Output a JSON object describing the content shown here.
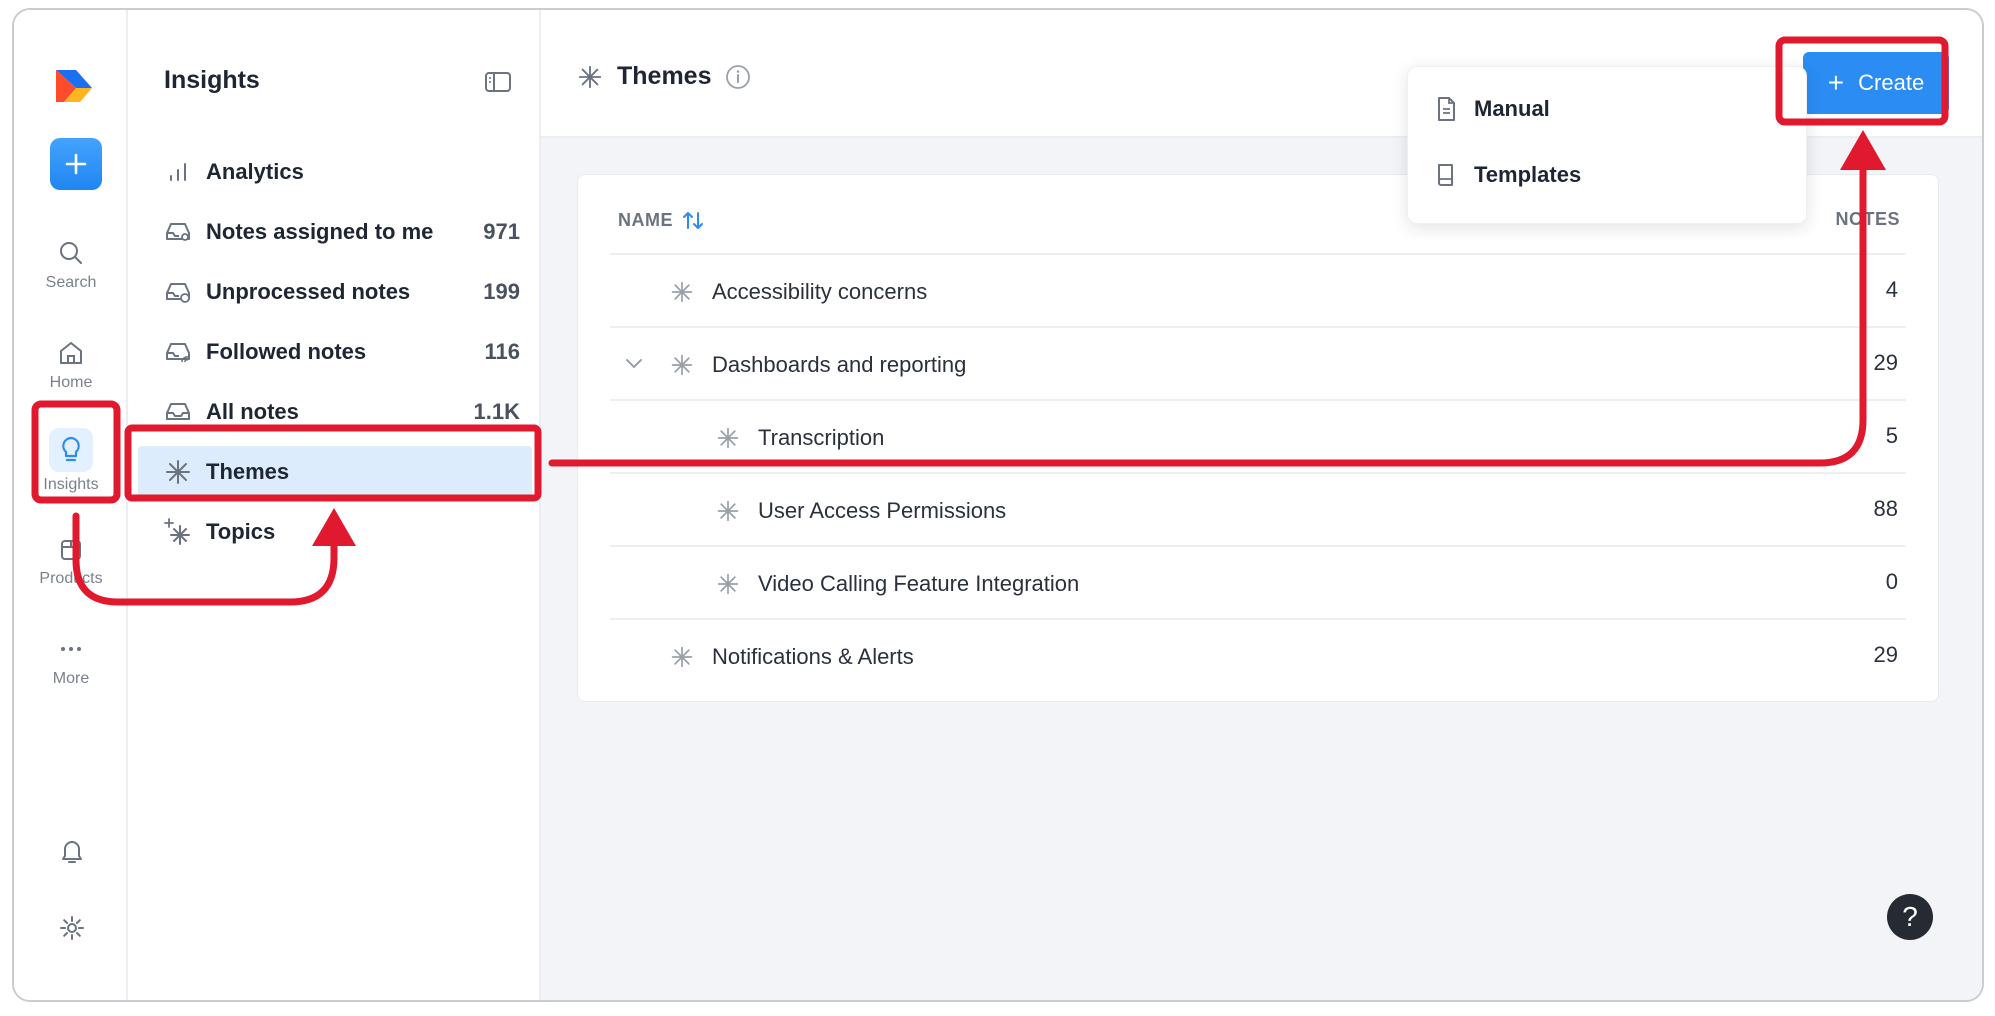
{
  "rail": {
    "items": [
      {
        "label": "Search",
        "icon": "search-icon"
      },
      {
        "label": "Home",
        "icon": "home-icon"
      },
      {
        "label": "Insights",
        "icon": "lightbulb-icon"
      },
      {
        "label": "Products",
        "icon": "box-icon"
      },
      {
        "label": "More",
        "icon": "dots-icon"
      }
    ]
  },
  "sidebar": {
    "title": "Insights",
    "items": [
      {
        "label": "Analytics",
        "count": "",
        "icon": "bar-chart-icon"
      },
      {
        "label": "Notes assigned to me",
        "count": "971",
        "icon": "inbox-user-icon"
      },
      {
        "label": "Unprocessed notes",
        "count": "199",
        "icon": "inbox-clock-icon"
      },
      {
        "label": "Followed notes",
        "count": "116",
        "icon": "inbox-wifi-icon"
      },
      {
        "label": "All notes",
        "count": "1.1K",
        "icon": "inbox-icon"
      },
      {
        "label": "Themes",
        "count": "",
        "icon": "asterisk-icon"
      },
      {
        "label": "Topics",
        "count": "",
        "icon": "sparkle-asterisk-icon"
      }
    ]
  },
  "main": {
    "title": "Themes",
    "create_label": "Create",
    "dropdown": [
      {
        "label": "Manual",
        "icon": "document-icon"
      },
      {
        "label": "Templates",
        "icon": "book-icon"
      }
    ],
    "table": {
      "col_name": "NAME",
      "col_notes": "NOTES",
      "rows": [
        {
          "name": "Accessibility concerns",
          "notes": "4",
          "level": 0,
          "expandable": false
        },
        {
          "name": "Dashboards and reporting",
          "notes": "29",
          "level": 0,
          "expandable": true
        },
        {
          "name": "Transcription",
          "notes": "5",
          "level": 1,
          "expandable": false
        },
        {
          "name": "User Access Permissions",
          "notes": "88",
          "level": 1,
          "expandable": false
        },
        {
          "name": "Video Calling Feature Integration",
          "notes": "0",
          "level": 1,
          "expandable": false
        },
        {
          "name": "Notifications & Alerts",
          "notes": "29",
          "level": 0,
          "expandable": false
        }
      ]
    },
    "help_label": "?"
  },
  "colors": {
    "accent": "#2b8cf3",
    "selected_bg": "#dcecfc",
    "annotation": "#e0192f"
  }
}
